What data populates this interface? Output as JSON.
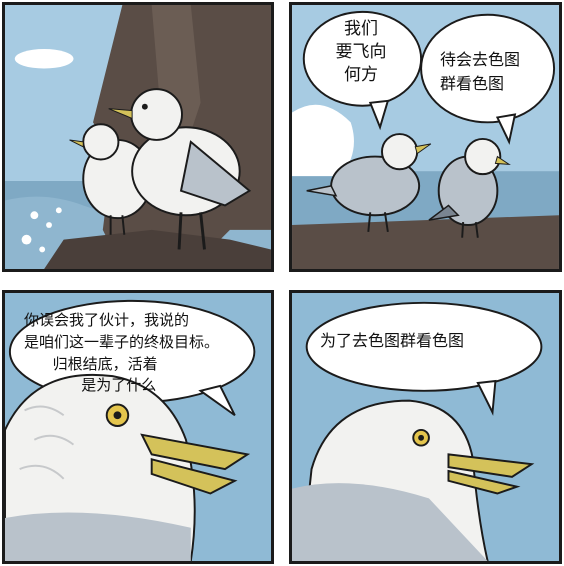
{
  "comic": {
    "panel1": {},
    "panel2": {
      "bubble_left": "我们\n要飞向\n何方",
      "bubble_right": "待会去色图\n群看色图"
    },
    "panel3": {
      "bubble": "你误会我了伙计，我说的\n是咱们这一辈子的终极目标。\n      归根结底，活着\n            是为了什么"
    },
    "panel4": {
      "bubble": "为了去色图群看色图"
    }
  },
  "colors": {
    "sky": "#9fc6df",
    "sea": "#7fa9c4",
    "rock": "#5a4d46",
    "gull_white": "#f2f2f0",
    "gull_gray": "#b9c2cb",
    "beak": "#d4c25a",
    "ink": "#1b1b1b"
  }
}
